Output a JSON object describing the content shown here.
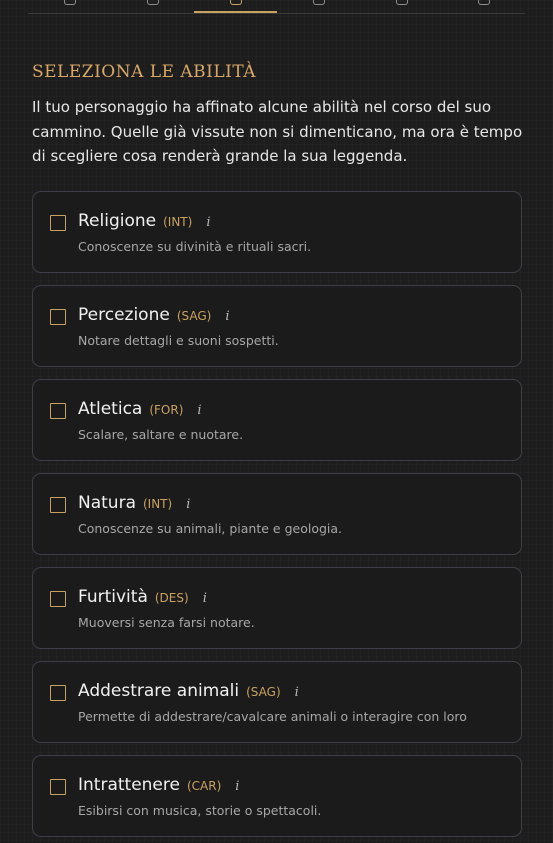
{
  "nav": {
    "tabs": [
      "",
      "",
      "",
      "",
      "",
      ""
    ],
    "active_index": 2
  },
  "header": {
    "title": "SELEZIONA LE ABILITÀ",
    "intro": "Il tuo personaggio ha affinato alcune abilità nel corso del suo cammino. Quelle già vissute non si dimenticano, ma ora è tempo di scegliere cosa renderà grande la sua leggenda."
  },
  "info_label": "i",
  "skills": [
    {
      "name": "Religione",
      "stat": "(INT)",
      "desc": "Conoscenze su divinità e rituali sacri.",
      "checked": false
    },
    {
      "name": "Percezione",
      "stat": "(SAG)",
      "desc": "Notare dettagli e suoni sospetti.",
      "checked": false
    },
    {
      "name": "Atletica",
      "stat": "(FOR)",
      "desc": "Scalare, saltare e nuotare.",
      "checked": false
    },
    {
      "name": "Natura",
      "stat": "(INT)",
      "desc": "Conoscenze su animali, piante e geologia.",
      "checked": false
    },
    {
      "name": "Furtività",
      "stat": "(DES)",
      "desc": "Muoversi senza farsi notare.",
      "checked": false
    },
    {
      "name": "Addestrare animali",
      "stat": "(SAG)",
      "desc": "Permette di addestrare/cavalcare animali o interagire con loro",
      "checked": false
    },
    {
      "name": "Intrattenere",
      "stat": "(CAR)",
      "desc": "Esibirsi con musica, storie o spettacoli.",
      "checked": false
    }
  ],
  "colors": {
    "accent": "#c9a25f",
    "background": "#1d1d1d",
    "card_border": "#3e3e48"
  }
}
